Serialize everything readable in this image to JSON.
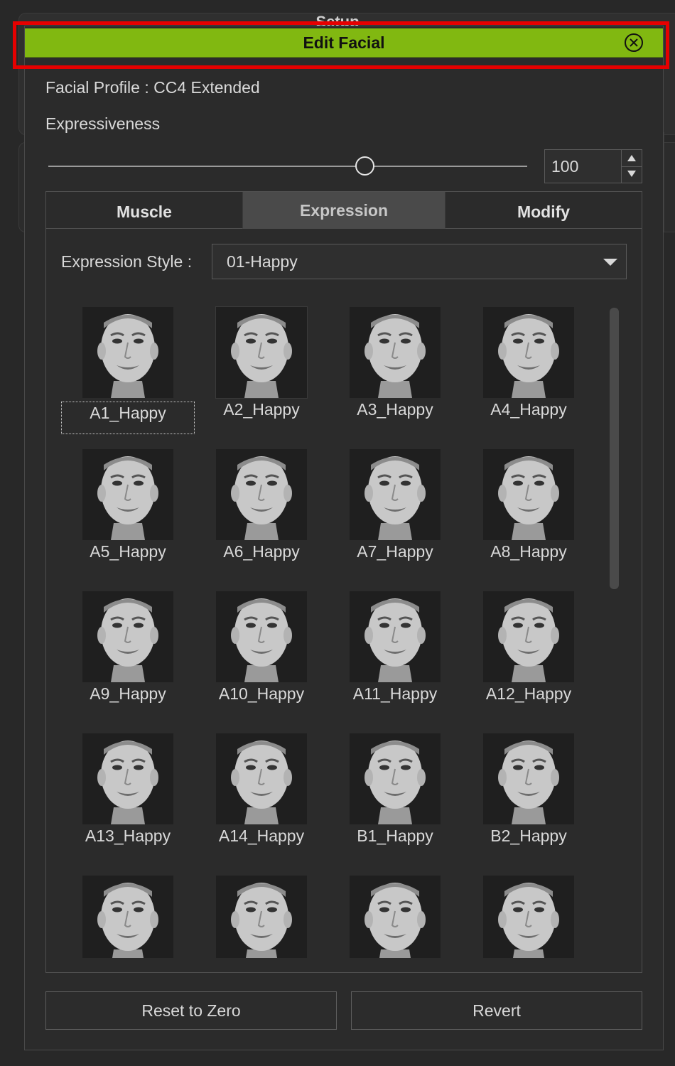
{
  "window": {
    "title": "Edit Facial",
    "background_title": "Setup"
  },
  "profile": {
    "label": "Facial Profile :",
    "value": "CC4 Extended"
  },
  "expressiveness": {
    "label": "Expressiveness",
    "value": "100",
    "slider_fraction": 0.66
  },
  "tabs": [
    {
      "label": "Muscle",
      "active": false
    },
    {
      "label": "Expression",
      "active": true
    },
    {
      "label": "Modify",
      "active": false
    }
  ],
  "expression_style": {
    "label": "Expression Style :",
    "selected": "01-Happy"
  },
  "expressions": [
    "A1_Happy",
    "A2_Happy",
    "A3_Happy",
    "A4_Happy",
    "A5_Happy",
    "A6_Happy",
    "A7_Happy",
    "A8_Happy",
    "A9_Happy",
    "A10_Happy",
    "A11_Happy",
    "A12_Happy",
    "A13_Happy",
    "A14_Happy",
    "B1_Happy",
    "B2_Happy",
    "",
    "",
    "",
    ""
  ],
  "buttons": {
    "reset": "Reset to Zero",
    "revert": "Revert"
  },
  "colors": {
    "title_bar": "#81b811",
    "highlight_box": "#e60000",
    "background": "#282828"
  },
  "icons": {
    "close": "close-circle-icon",
    "dropdown": "chevron-down-icon",
    "spin_up": "triangle-up-icon",
    "spin_down": "triangle-down-icon"
  }
}
